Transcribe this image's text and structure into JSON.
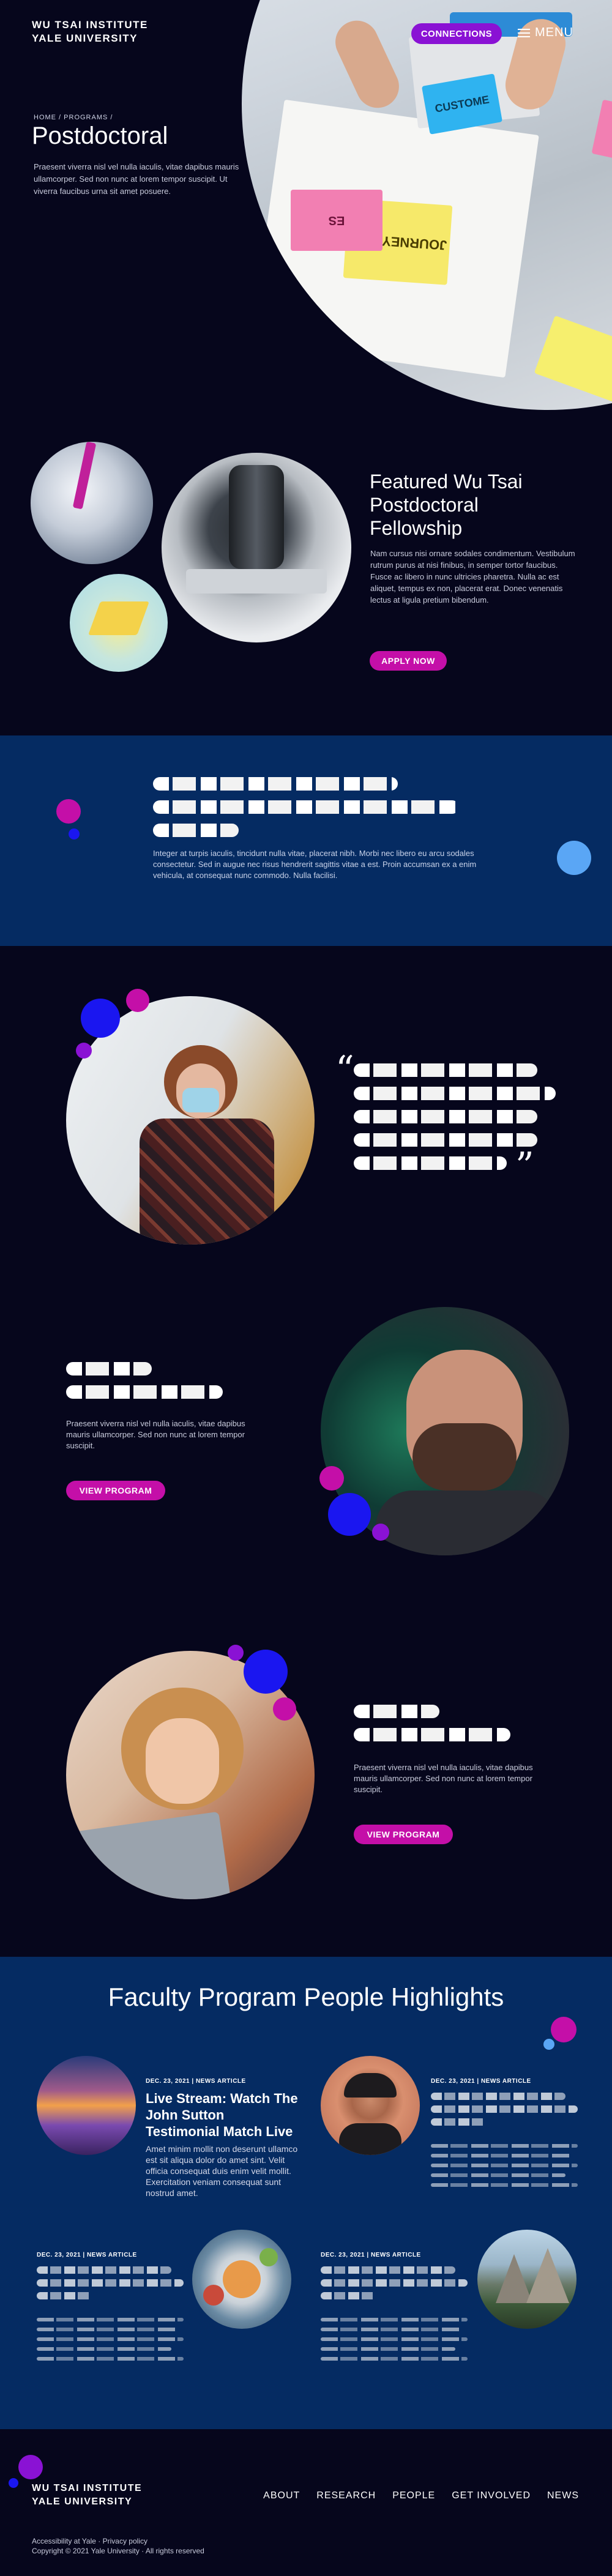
{
  "header": {
    "logo_line1": "WU TSAI INSTITUTE",
    "logo_line2": "YALE UNIVERSITY",
    "connections_label": "CONNECTIONS",
    "menu_label": "MENU"
  },
  "hero": {
    "breadcrumb": "HOME  /  PROGRAMS  /",
    "title": "Postdoctoral",
    "body": "Praesent viverra nisl vel nulla iaculis, vitae dapibus mauris ullamcorper. Sed non nunc at lorem tempor suscipit. Ut viverra faucibus urna sit amet posuere.",
    "sticky_notes": [
      "CUSTOME",
      "JOURNEY MAP",
      "ES"
    ]
  },
  "fellowship": {
    "title": "Featured Wu Tsai Postdoctoral Fellowship",
    "body": "Nam cursus nisi ornare sodales condimentum. Vestibulum rutrum purus at nisi finibus, in semper tortor faucibus. Fusce ac libero in nunc ultricies pharetra. Nulla ac est aliquet, tempus ex non, placerat erat. Donec venenatis lectus at ligula pretium bibendum.",
    "apply_label": "APPLY NOW"
  },
  "band": {
    "body": "Integer at turpis iaculis, tincidunt nulla vitae, placerat nibh. Morbi nec libero eu arcu sodales consectetur. Sed in augue nec risus hendrerit sagittis vitae a est. Proin accumsan ex a enim vehicula, at consequat nunc commodo. Nulla facilisi."
  },
  "programs": [
    {
      "body": "Praesent viverra nisl vel nulla iaculis, vitae dapibus mauris ullamcorper. Sed non nunc at lorem tempor suscipit.",
      "button": "VIEW PROGRAM"
    },
    {
      "body": "Praesent viverra nisl vel nulla iaculis, vitae dapibus mauris ullamcorper. Sed non nunc at lorem tempor suscipit.",
      "button": "VIEW PROGRAM"
    }
  ],
  "highlights": {
    "title": "Faculty Program People Highlights",
    "cards": [
      {
        "meta": "DEC. 23, 2021  |  NEWS ARTICLE",
        "title": "Live Stream: Watch The John Sutton Testimonial Match Live",
        "body": "Amet minim mollit non deserunt ullamco est sit aliqua dolor do amet sint. Velit officia consequat duis enim velit mollit. Exercitation veniam consequat sunt nostrud amet."
      },
      {
        "meta": "DEC. 23, 2021  |  NEWS ARTICLE"
      },
      {
        "meta": "DEC. 23, 2021  |  NEWS ARTICLE"
      },
      {
        "meta": "DEC. 23, 2021  |  NEWS ARTICLE"
      }
    ]
  },
  "footer": {
    "logo_line1": "WU TSAI INSTITUTE",
    "logo_line2": "YALE UNIVERSITY",
    "nav": [
      "ABOUT",
      "RESEARCH",
      "PEOPLE",
      "GET INVOLVED",
      "NEWS"
    ],
    "legal": "Accessibility at Yale · Privacy policy",
    "copyright": "Copyright © 2021 Yale University · All rights reserved"
  },
  "colors": {
    "background": "#06061c",
    "band": "#052b62",
    "accent_purple": "#8a12d4",
    "accent_pink": "#c40fa8",
    "accent_blue": "#1a16f0"
  }
}
